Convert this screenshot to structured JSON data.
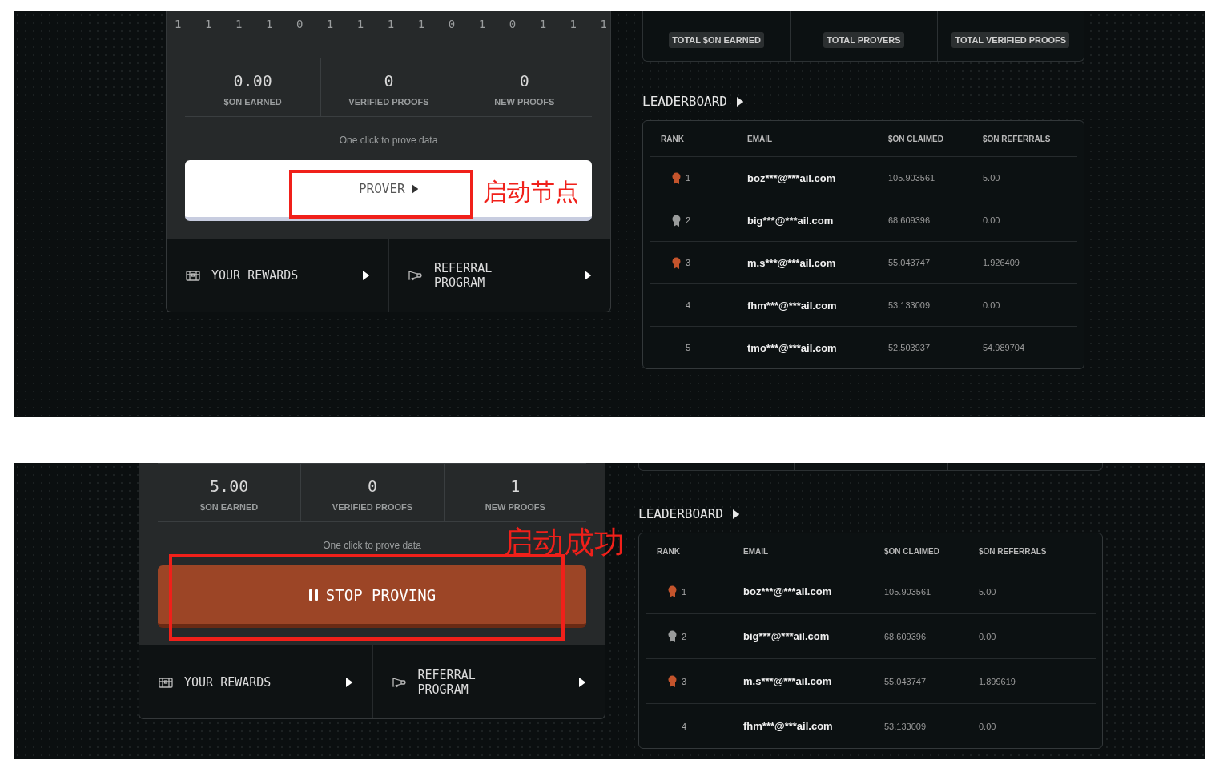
{
  "panels": [
    {
      "bits": [
        "1",
        "1",
        "1",
        "1",
        "0",
        "1",
        "1",
        "1",
        "1",
        "0",
        "1",
        "0",
        "1",
        "1",
        "1"
      ],
      "stats": [
        {
          "value": "0.00",
          "label": "$ON EARNED"
        },
        {
          "value": "0",
          "label": "VERIFIED PROOFS"
        },
        {
          "value": "0",
          "label": "NEW PROOFS"
        }
      ],
      "hint": "One click to prove data",
      "prove_button": {
        "label": "PROVER",
        "proving": false
      },
      "annotation": {
        "text": "启动节点",
        "boxed": true
      },
      "nav": [
        {
          "kind": "rewards",
          "label": "YOUR REWARDS"
        },
        {
          "kind": "referral",
          "label": "REFERRAL PROGRAM"
        }
      ],
      "totals": [
        "TOTAL $ON EARNED",
        "TOTAL PROVERS",
        "TOTAL VERIFIED PROOFS"
      ],
      "leaderboard": {
        "title": "LEADERBOARD",
        "columns": [
          "RANK",
          "EMAIL",
          "$ON CLAIMED",
          "$ON REFERRALS"
        ],
        "rows": [
          {
            "rank": "1",
            "color": "#c4542c",
            "email": "boz***@***ail.com",
            "claimed": "105.903561",
            "referrals": "5.00"
          },
          {
            "rank": "2",
            "color": "#9a9c9c",
            "email": "big***@***ail.com",
            "claimed": "68.609396",
            "referrals": "0.00"
          },
          {
            "rank": "3",
            "color": "#c4542c",
            "email": "m.s***@***ail.com",
            "claimed": "55.043747",
            "referrals": "1.926409"
          },
          {
            "rank": "4",
            "email": "fhm***@***ail.com",
            "claimed": "53.133009",
            "referrals": "0.00"
          },
          {
            "rank": "5",
            "email": "tmo***@***ail.com",
            "claimed": "52.503937",
            "referrals": "54.989704"
          }
        ]
      }
    },
    {
      "stats": [
        {
          "value": "5.00",
          "label": "$ON EARNED"
        },
        {
          "value": "0",
          "label": "VERIFIED PROOFS"
        },
        {
          "value": "1",
          "label": "NEW PROOFS"
        }
      ],
      "hint": "One click to prove data",
      "prove_button": {
        "label": "STOP PROVING",
        "proving": true
      },
      "annotation": {
        "text": "启动成功",
        "boxed": true
      },
      "nav": [
        {
          "kind": "rewards",
          "label": "YOUR REWARDS"
        },
        {
          "kind": "referral",
          "label": "REFERRAL PROGRAM"
        }
      ],
      "leaderboard": {
        "title": "LEADERBOARD",
        "columns": [
          "RANK",
          "EMAIL",
          "$ON CLAIMED",
          "$ON REFERRALS"
        ],
        "rows": [
          {
            "rank": "1",
            "color": "#c4542c",
            "email": "boz***@***ail.com",
            "claimed": "105.903561",
            "referrals": "5.00"
          },
          {
            "rank": "2",
            "color": "#9a9c9c",
            "email": "big***@***ail.com",
            "claimed": "68.609396",
            "referrals": "0.00"
          },
          {
            "rank": "3",
            "color": "#c4542c",
            "email": "m.s***@***ail.com",
            "claimed": "55.043747",
            "referrals": "1.899619"
          },
          {
            "rank": "4",
            "email": "fhm***@***ail.com",
            "claimed": "53.133009",
            "referrals": "0.00"
          }
        ]
      }
    }
  ]
}
